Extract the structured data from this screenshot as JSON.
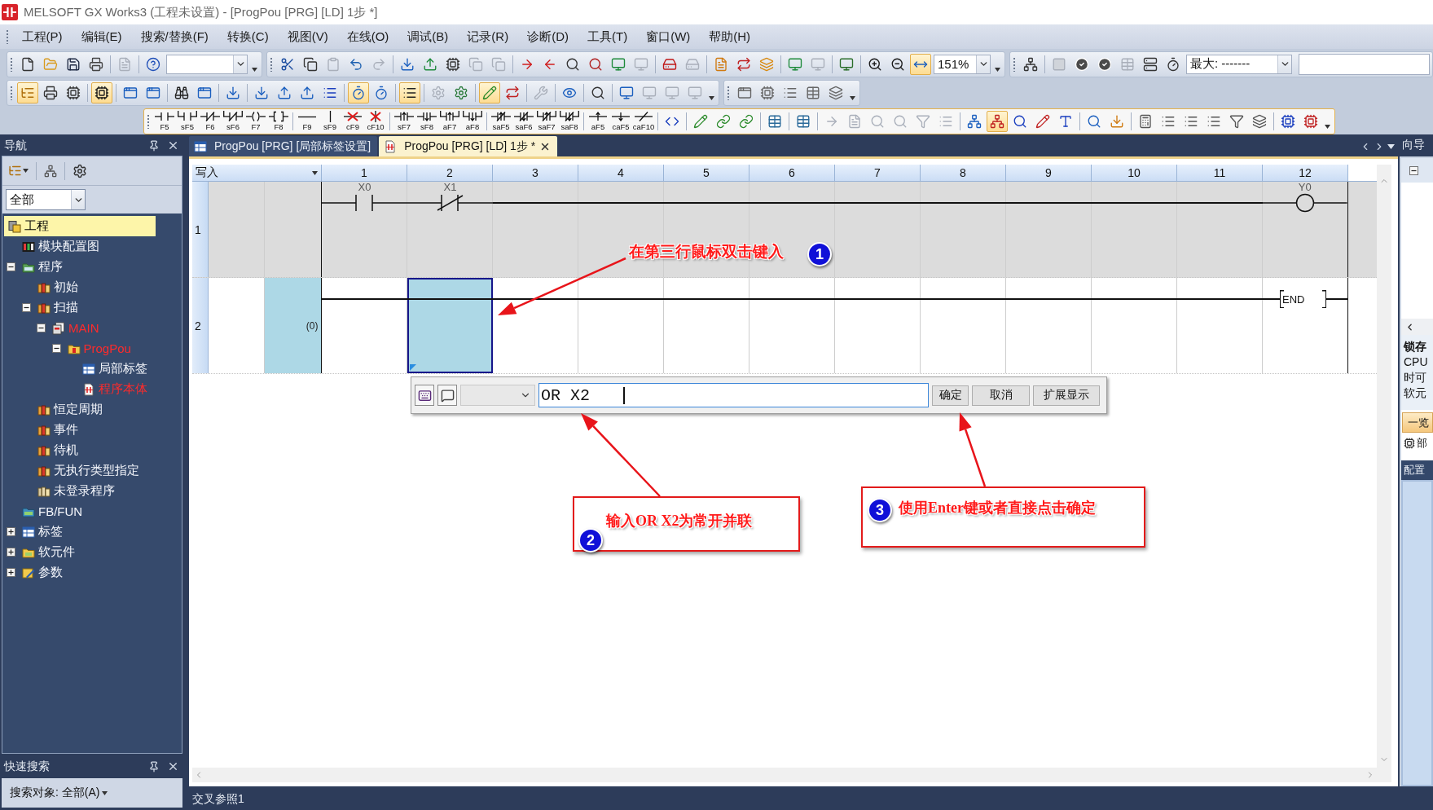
{
  "window": {
    "title": "MELSOFT GX Works3 (工程未设置) - [ProgPou [PRG] [LD] 1步 *]"
  },
  "menu": [
    "工程(P)",
    "编辑(E)",
    "搜索/替换(F)",
    "转换(C)",
    "视图(V)",
    "在线(O)",
    "调试(B)",
    "记录(R)",
    "诊断(D)",
    "工具(T)",
    "窗口(W)",
    "帮助(H)"
  ],
  "toolbar_rows": [
    [
      {
        "items": [
          {
            "kind": "button",
            "on": false,
            "disabled": false
          },
          {
            "kind": "button",
            "on": false,
            "disabled": false
          },
          {
            "kind": "button",
            "on": false,
            "disabled": false
          },
          {
            "kind": "button",
            "on": false,
            "disabled": false
          },
          {
            "kind": "separator"
          },
          {
            "kind": "button",
            "on": false,
            "disabled": true
          },
          {
            "kind": "separator"
          },
          {
            "kind": "button",
            "on": false,
            "disabled": false
          },
          {
            "kind": "combo"
          },
          {
            "kind": "overflow"
          }
        ]
      },
      {
        "items": [
          {
            "kind": "button",
            "on": false,
            "disabled": false
          },
          {
            "kind": "button",
            "on": false,
            "disabled": false
          },
          {
            "kind": "button",
            "on": false,
            "disabled": true
          },
          {
            "kind": "button",
            "on": false,
            "disabled": false
          },
          {
            "kind": "button",
            "on": false,
            "disabled": true
          },
          {
            "kind": "separator"
          },
          {
            "kind": "button",
            "on": false,
            "disabled": false
          },
          {
            "kind": "button",
            "on": false,
            "disabled": false
          },
          {
            "kind": "button",
            "on": false,
            "disabled": false
          },
          {
            "kind": "button",
            "on": false,
            "disabled": true
          },
          {
            "kind": "button",
            "on": false,
            "disabled": true
          },
          {
            "kind": "separator"
          },
          {
            "kind": "button",
            "on": false,
            "disabled": false
          },
          {
            "kind": "button",
            "on": false,
            "disabled": false
          },
          {
            "kind": "button",
            "on": false,
            "disabled": false
          },
          {
            "kind": "button",
            "on": false,
            "disabled": false
          },
          {
            "kind": "button",
            "on": false,
            "disabled": false
          },
          {
            "kind": "button",
            "on": false,
            "disabled": true
          },
          {
            "kind": "separator"
          },
          {
            "kind": "button",
            "on": false,
            "disabled": false
          },
          {
            "kind": "button",
            "on": false,
            "disabled": true
          },
          {
            "kind": "separator"
          },
          {
            "kind": "button",
            "on": false,
            "disabled": false
          },
          {
            "kind": "button",
            "on": false,
            "disabled": false
          },
          {
            "kind": "button",
            "on": false,
            "disabled": false
          },
          {
            "kind": "separator"
          },
          {
            "kind": "button",
            "on": false,
            "disabled": false
          },
          {
            "kind": "button",
            "on": false,
            "disabled": true
          },
          {
            "kind": "separator"
          },
          {
            "kind": "button",
            "on": false,
            "disabled": false
          },
          {
            "kind": "separator"
          },
          {
            "kind": "button",
            "on": false,
            "disabled": false
          },
          {
            "kind": "button",
            "on": false,
            "disabled": false
          },
          {
            "kind": "button",
            "on": true,
            "disabled": false
          },
          {
            "kind": "combo",
            "value": "151%"
          },
          {
            "kind": "overflow"
          }
        ]
      },
      {
        "items": [
          {
            "kind": "button",
            "on": false,
            "disabled": false
          },
          {
            "kind": "separator"
          },
          {
            "kind": "button",
            "on": false,
            "disabled": true
          },
          {
            "kind": "button",
            "on": false,
            "disabled": false
          },
          {
            "kind": "button",
            "on": false,
            "disabled": false
          },
          {
            "kind": "button",
            "on": false,
            "disabled": true
          },
          {
            "kind": "button",
            "on": false,
            "disabled": false
          },
          {
            "kind": "button",
            "on": false,
            "disabled": false
          },
          {
            "kind": "combo",
            "value": "最大: -------"
          },
          {
            "kind": "field"
          }
        ]
      }
    ],
    [
      {
        "items": [
          {
            "kind": "button",
            "on": true,
            "disabled": false
          },
          {
            "kind": "button",
            "on": false,
            "disabled": false
          },
          {
            "kind": "button",
            "on": false,
            "disabled": false
          },
          {
            "kind": "separator"
          },
          {
            "kind": "button",
            "on": true,
            "disabled": false
          },
          {
            "kind": "separator"
          },
          {
            "kind": "button",
            "on": false,
            "disabled": false
          },
          {
            "kind": "button",
            "on": false,
            "disabled": false
          },
          {
            "kind": "separator"
          },
          {
            "kind": "button",
            "on": false,
            "disabled": false
          },
          {
            "kind": "button",
            "on": false,
            "disabled": false
          },
          {
            "kind": "separator"
          },
          {
            "kind": "button",
            "on": false,
            "disabled": false
          },
          {
            "kind": "separator"
          },
          {
            "kind": "button",
            "on": false,
            "disabled": false
          },
          {
            "kind": "button",
            "on": false,
            "disabled": false
          },
          {
            "kind": "button",
            "on": false,
            "disabled": false
          },
          {
            "kind": "button",
            "on": false,
            "disabled": false
          },
          {
            "kind": "separator"
          },
          {
            "kind": "button",
            "on": true,
            "disabled": false
          },
          {
            "kind": "button",
            "on": false,
            "disabled": false
          },
          {
            "kind": "separator"
          },
          {
            "kind": "button",
            "on": true,
            "disabled": false
          },
          {
            "kind": "separator"
          },
          {
            "kind": "button",
            "on": false,
            "disabled": true
          },
          {
            "kind": "button",
            "on": false,
            "disabled": false
          },
          {
            "kind": "separator"
          },
          {
            "kind": "button",
            "on": true,
            "disabled": false
          },
          {
            "kind": "button",
            "on": false,
            "disabled": false
          },
          {
            "kind": "separator"
          },
          {
            "kind": "button",
            "on": false,
            "disabled": true
          },
          {
            "kind": "separator"
          },
          {
            "kind": "button",
            "on": false,
            "disabled": false
          },
          {
            "kind": "separator"
          },
          {
            "kind": "button",
            "on": false,
            "disabled": false
          },
          {
            "kind": "separator"
          },
          {
            "kind": "button",
            "on": false,
            "disabled": false
          },
          {
            "kind": "button",
            "on": false,
            "disabled": true
          },
          {
            "kind": "button",
            "on": false,
            "disabled": true
          },
          {
            "kind": "button",
            "on": false,
            "disabled": true
          },
          {
            "kind": "overflow"
          }
        ]
      },
      {
        "items": [
          {
            "kind": "button",
            "on": false,
            "disabled": false
          },
          {
            "kind": "button",
            "on": false,
            "disabled": false
          },
          {
            "kind": "button",
            "on": false,
            "disabled": false
          },
          {
            "kind": "button",
            "on": false,
            "disabled": false
          },
          {
            "kind": "button",
            "on": false,
            "disabled": false
          },
          {
            "kind": "overflow"
          }
        ]
      }
    ],
    [
      {
        "items": [
          {
            "kind": "open-contact",
            "label": "F5"
          },
          {
            "kind": "parallel-open-contact",
            "label": "sF5"
          },
          {
            "kind": "closed-contact",
            "label": "F6"
          },
          {
            "kind": "parallel-closed-contact",
            "label": "sF6"
          },
          {
            "kind": "coil",
            "label": "F7"
          },
          {
            "kind": "instruction",
            "label": "F8"
          },
          {
            "kind": "separator"
          },
          {
            "kind": "horizontal-line",
            "label": "F9"
          },
          {
            "kind": "vertical-line",
            "label": "sF9"
          },
          {
            "kind": "delete-horizontal",
            "label": "cF9"
          },
          {
            "kind": "delete-vertical",
            "label": "cF10"
          },
          {
            "kind": "separator"
          },
          {
            "kind": "rising-contact",
            "label": "sF7"
          },
          {
            "kind": "falling-contact",
            "label": "sF8"
          },
          {
            "kind": "parallel-rising-contact",
            "label": "aF7"
          },
          {
            "kind": "parallel-falling-contact",
            "label": "aF8"
          },
          {
            "kind": "separator"
          },
          {
            "kind": "rising-closed-contact",
            "label": "saF5"
          },
          {
            "kind": "falling-closed-contact",
            "label": "saF6"
          },
          {
            "kind": "parallel-rising-closed-contact",
            "label": "saF7"
          },
          {
            "kind": "parallel-falling-closed-contact",
            "label": "saF8"
          },
          {
            "kind": "separator"
          },
          {
            "kind": "rising-edge",
            "label": "aF5"
          },
          {
            "kind": "falling-edge",
            "label": "caF5"
          },
          {
            "kind": "invert",
            "label": "caF10"
          },
          {
            "kind": "separator"
          },
          {
            "kind": "button",
            "on": false,
            "disabled": false
          },
          {
            "kind": "separator"
          },
          {
            "kind": "button",
            "on": false,
            "disabled": false
          },
          {
            "kind": "button",
            "on": false,
            "disabled": false
          },
          {
            "kind": "button",
            "on": false,
            "disabled": false
          },
          {
            "kind": "separator"
          },
          {
            "kind": "button",
            "on": false,
            "disabled": false
          },
          {
            "kind": "separator"
          },
          {
            "kind": "button",
            "on": false,
            "disabled": false
          },
          {
            "kind": "separator"
          },
          {
            "kind": "button",
            "on": false,
            "disabled": true
          },
          {
            "kind": "button",
            "on": false,
            "disabled": true
          },
          {
            "kind": "button",
            "on": false,
            "disabled": true
          },
          {
            "kind": "button",
            "on": false,
            "disabled": true
          },
          {
            "kind": "button",
            "on": false,
            "disabled": true
          },
          {
            "kind": "button",
            "on": false,
            "disabled": true
          },
          {
            "kind": "separator"
          },
          {
            "kind": "button",
            "on": false,
            "disabled": false
          },
          {
            "kind": "button",
            "on": true,
            "disabled": false
          },
          {
            "kind": "button",
            "on": false,
            "disabled": false
          },
          {
            "kind": "button",
            "on": false,
            "disabled": false
          },
          {
            "kind": "button",
            "on": false,
            "disabled": false
          },
          {
            "kind": "separator"
          },
          {
            "kind": "button",
            "on": false,
            "disabled": false
          },
          {
            "kind": "button",
            "on": false,
            "disabled": false
          },
          {
            "kind": "separator"
          },
          {
            "kind": "button",
            "on": false,
            "disabled": false
          },
          {
            "kind": "button",
            "on": false,
            "disabled": false
          },
          {
            "kind": "button",
            "on": false,
            "disabled": false
          },
          {
            "kind": "button",
            "on": false,
            "disabled": false
          },
          {
            "kind": "button",
            "on": false,
            "disabled": false
          },
          {
            "kind": "button",
            "on": false,
            "disabled": false
          },
          {
            "kind": "separator"
          },
          {
            "kind": "button",
            "on": false,
            "disabled": false
          },
          {
            "kind": "button",
            "on": false,
            "disabled": false
          },
          {
            "kind": "overflow"
          }
        ]
      }
    ]
  ],
  "navigation": {
    "title": "导航",
    "filter": "全部",
    "tree": [
      {
        "label": "工程",
        "kind": "project",
        "selected": true,
        "unconverted": false,
        "children": [
          {
            "label": "模块配置图",
            "kind": "module",
            "selected": false,
            "unconverted": false
          },
          {
            "label": "程序",
            "kind": "programs",
            "selected": false,
            "unconverted": false,
            "expanded": true,
            "children": [
              {
                "label": "初始",
                "kind": "task",
                "selected": false,
                "unconverted": false
              },
              {
                "label": "扫描",
                "kind": "task",
                "selected": false,
                "unconverted": false,
                "expanded": true,
                "children": [
                  {
                    "label": "MAIN",
                    "kind": "program",
                    "selected": false,
                    "unconverted": true,
                    "expanded": true,
                    "children": [
                      {
                        "label": "ProgPou",
                        "kind": "pou",
                        "selected": false,
                        "unconverted": true,
                        "expanded": true,
                        "children": [
                          {
                            "label": "局部标签",
                            "kind": "labels",
                            "selected": false,
                            "unconverted": false
                          },
                          {
                            "label": "程序本体",
                            "kind": "body",
                            "selected": false,
                            "unconverted": true
                          }
                        ]
                      }
                    ]
                  }
                ]
              },
              {
                "label": "恒定周期",
                "kind": "task",
                "selected": false,
                "unconverted": false
              },
              {
                "label": "事件",
                "kind": "task",
                "selected": false,
                "unconverted": false
              },
              {
                "label": "待机",
                "kind": "task",
                "selected": false,
                "unconverted": false
              },
              {
                "label": "无执行类型指定",
                "kind": "task",
                "selected": false,
                "unconverted": false
              },
              {
                "label": "未登录程序",
                "kind": "unregistered",
                "selected": false,
                "unconverted": false
              }
            ]
          },
          {
            "label": "FB/FUN",
            "kind": "fb",
            "selected": false,
            "unconverted": false
          },
          {
            "label": "标签",
            "kind": "label-folder",
            "selected": false,
            "unconverted": false,
            "expanded": false
          },
          {
            "label": "软元件",
            "kind": "device-folder",
            "selected": false,
            "unconverted": false,
            "expanded": false
          },
          {
            "label": "参数",
            "kind": "parameter-folder",
            "selected": false,
            "unconverted": false,
            "expanded": false
          }
        ]
      }
    ]
  },
  "quick_search": {
    "title": "快速搜索",
    "scope": "搜索对象: 全部(A)"
  },
  "tabs": [
    {
      "label": "ProgPou [PRG] [局部标签设置]",
      "kind": "labels",
      "selected": false
    },
    {
      "label": "ProgPou [PRG] [LD] 1步 *",
      "kind": "ladder",
      "selected": true
    }
  ],
  "ladder": {
    "mode": "写入",
    "columns": [
      "1",
      "2",
      "3",
      "4",
      "5",
      "6",
      "7",
      "8",
      "9",
      "10",
      "11",
      "12"
    ],
    "rows": [
      {
        "number": "1",
        "edited": true,
        "selected": false,
        "cells": [
          {
            "kind": "open-contact",
            "device": "X0",
            "selected": false
          },
          {
            "kind": "closed-contact",
            "device": "X1",
            "selected": false
          },
          {
            "kind": "wire",
            "selected": false
          },
          {
            "kind": "wire",
            "selected": false
          },
          {
            "kind": "wire",
            "selected": false
          },
          {
            "kind": "wire",
            "selected": false
          },
          {
            "kind": "wire",
            "selected": false
          },
          {
            "kind": "wire",
            "selected": false
          },
          {
            "kind": "wire",
            "selected": false
          },
          {
            "kind": "wire",
            "selected": false
          },
          {
            "kind": "wire",
            "selected": false
          },
          {
            "kind": "coil",
            "device": "Y0",
            "selected": false
          }
        ]
      },
      {
        "number": "2",
        "step": "(0)",
        "edited": false,
        "selected": true,
        "cells": [
          {
            "kind": "wire",
            "selected": false
          },
          {
            "kind": "wire",
            "selected": true
          },
          {
            "kind": "wire",
            "selected": false
          },
          {
            "kind": "wire",
            "selected": false
          },
          {
            "kind": "wire",
            "selected": false
          },
          {
            "kind": "wire",
            "selected": false
          },
          {
            "kind": "wire",
            "selected": false
          },
          {
            "kind": "wire",
            "selected": false
          },
          {
            "kind": "wire",
            "selected": false
          },
          {
            "kind": "wire",
            "selected": false
          },
          {
            "kind": "wire",
            "selected": false
          },
          {
            "kind": "end",
            "instruction": "END",
            "selected": false
          }
        ]
      }
    ]
  },
  "input_bar": {
    "value": "OR X2",
    "buttons": [
      "确定",
      "取消",
      "扩展显示"
    ]
  },
  "side_panel": {
    "title": "向导",
    "node_expanded": true,
    "info_title": "锁存",
    "info_lines": [
      "CPU",
      "时可",
      "软元"
    ],
    "button": "一览",
    "item": "部",
    "section": "配置"
  },
  "bottom_panel": {
    "tabs": [
      "交叉参照1"
    ]
  },
  "annotations": [
    {
      "kind": "note",
      "number": "1",
      "text": "在第三行鼠标双击键入"
    },
    {
      "kind": "box",
      "number": "2",
      "text": "输入OR X2为常开并联"
    },
    {
      "kind": "box",
      "number": "3",
      "text": "使用Enter键或者直接点击确定"
    }
  ]
}
